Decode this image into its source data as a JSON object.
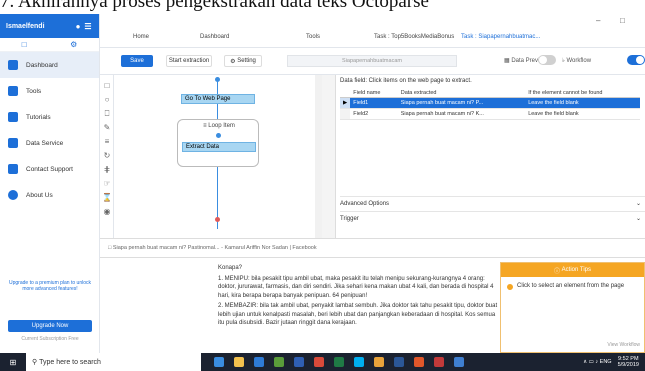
{
  "caption": "7. Akhirannya proses pengekstrakan data teks Octoparse",
  "sidebar": {
    "username": "Ismaelfendi",
    "items": [
      {
        "label": "Dashboard",
        "color": "#1d6fd8"
      },
      {
        "label": "Tools",
        "color": "#1d6fd8"
      },
      {
        "label": "Tutorials",
        "color": "#1d6fd8"
      },
      {
        "label": "Data Service",
        "color": "#1d6fd8"
      },
      {
        "label": "Contact Support",
        "color": "#1d6fd8"
      },
      {
        "label": "About Us",
        "color": "#1d6fd8"
      }
    ],
    "upgrade_text": "Upgrade to a premium plan to unlock more advanced features!",
    "upgrade_button": "Upgrade Now",
    "subscription": "Current Subscription Free"
  },
  "tabs": [
    {
      "label": "Home"
    },
    {
      "label": "Dashboard"
    },
    {
      "label": "Tools"
    },
    {
      "label": "Task : Top5BooksMediaBonus"
    },
    {
      "label": "Task : Siapapernahbuatmac..."
    }
  ],
  "toolbar": {
    "save": "Save",
    "start_extraction": "Start extraction",
    "setting": "Setting",
    "url": "Siapapernahbuatmacam",
    "data_preview": "Data Preview",
    "workflow": "Workflow"
  },
  "workflow": {
    "nodes": [
      "Go To Web Page",
      "Loop Item",
      "Extract Data"
    ]
  },
  "datafield": {
    "title": "Data field: Click items on the web page to extract.",
    "columns": [
      "Field name",
      "Data extracted",
      "If the element cannot be found"
    ],
    "rows": [
      {
        "name": "Field1",
        "data": "Siapa pernah buat macam ni? P...",
        "fallback": "Leave the field blank"
      },
      {
        "name": "Field2",
        "data": "Siapa pernah buat macam ni? K...",
        "fallback": "Leave the field blank"
      }
    ],
    "advanced": "Advanced Options",
    "trigger": "Trigger"
  },
  "browser": {
    "page_title": "Siapa pernah buat macam ni? Pastinomal... - Kamarul Ariffin Nor Sadan | Facebook"
  },
  "webcontent": {
    "heading": "Konapa?",
    "para1": "1. MENIPU: bila pesakit tipu ambil ubat, maka pesakit itu telah menipu sekurang-kurangnya 4 orang: doktor, jururawat, farmasis, dan diri sendiri. Jika sehari kena makan ubat 4 kali, dan berada di hospital 4 hari, kira berapa berapa banyak penipuan. 64 penipuan!",
    "para2": "2. MEMBAZIR: bila tak ambil ubat, penyakit lambat sembuh. Jika doktor tak tahu pesakit tipu, doktor buat lebih ujian untuk kenalpasti masalah, beri lebih ubat dan panjangkan keberadaan di hospital. Kos semua itu pula disubsidi. Bazir jutaan ringgit dana kerajaan."
  },
  "tips": {
    "title": "Action Tips",
    "body": "Click to select an element from the page",
    "footer": "View Workflow"
  },
  "taskbar": {
    "search": "Type here to search",
    "lang": "ENG",
    "time": "9:52 PM",
    "date": "5/9/2019"
  }
}
